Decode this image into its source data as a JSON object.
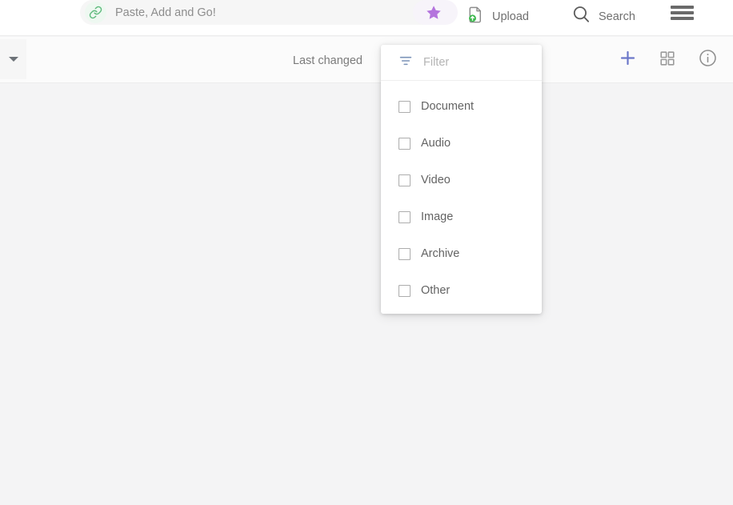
{
  "topbar": {
    "paste_pill": {
      "icon": "link-icon",
      "label": "Paste, Add and Go!"
    },
    "favorites": {
      "icon": "star-icon"
    },
    "upload": {
      "icon": "upload-file-icon",
      "label": "Upload"
    },
    "search": {
      "icon": "search-icon",
      "label": "Search"
    },
    "menu": {
      "icon": "hamburger-menu-icon"
    }
  },
  "subtoolbar": {
    "collapse": {
      "icon": "chevron-down-icon"
    },
    "sort_label": "Last changed",
    "actions": [
      {
        "icon": "plus-icon",
        "name": "add-button"
      },
      {
        "icon": "grid-view-icon",
        "name": "grid-view-button"
      },
      {
        "icon": "info-circle-icon",
        "name": "info-button"
      }
    ]
  },
  "filter_panel": {
    "header": {
      "icon": "filter-icon",
      "label": "Filter"
    },
    "options": [
      {
        "label": "Document",
        "checked": false
      },
      {
        "label": "Audio",
        "checked": false
      },
      {
        "label": "Video",
        "checked": false
      },
      {
        "label": "Image",
        "checked": false
      },
      {
        "label": "Archive",
        "checked": false
      },
      {
        "label": "Other",
        "checked": false
      }
    ]
  },
  "colors": {
    "accent_blue": "#6b77c9",
    "star_purple": "#b474dd",
    "link_green": "#5fba7d",
    "upload_green": "#3fb950",
    "filter_icon": "#7b93b8",
    "page_bg": "#f4f4f5",
    "panel_bg": "#ffffff"
  }
}
